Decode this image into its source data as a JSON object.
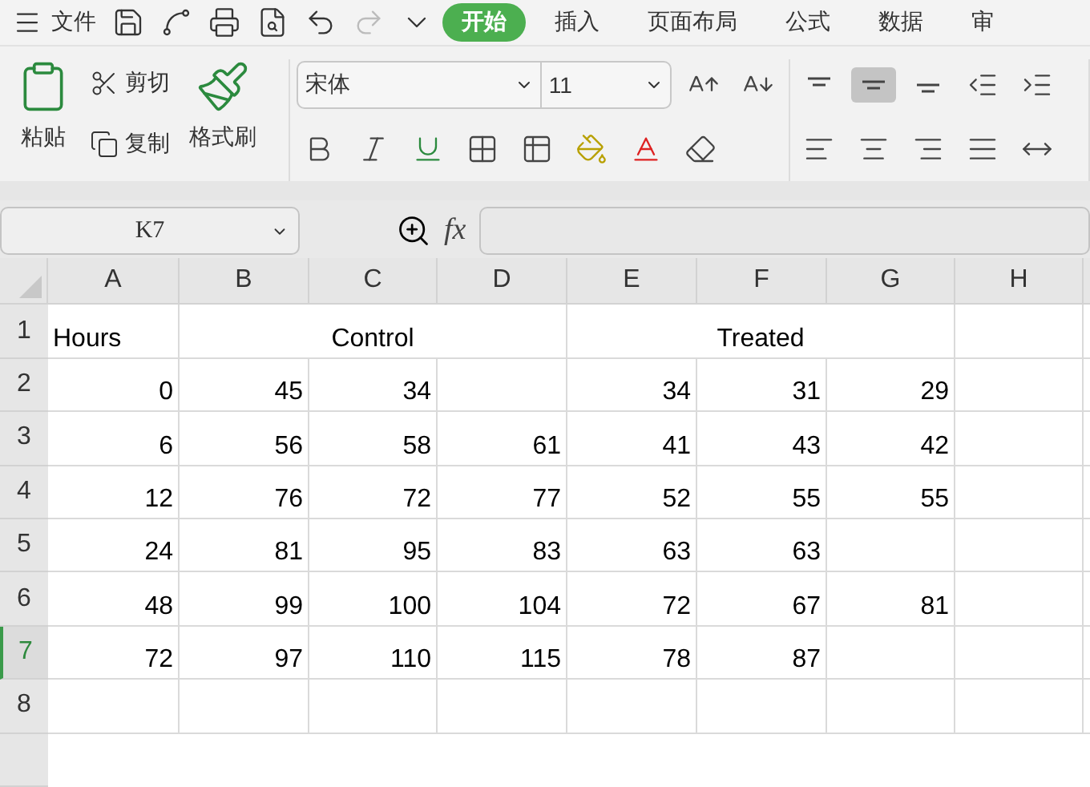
{
  "menu": {
    "label": "文件"
  },
  "tabs": [
    {
      "label": "开始",
      "selected": true
    },
    {
      "label": "插入",
      "selected": false
    },
    {
      "label": "页面布局",
      "selected": false
    },
    {
      "label": "公式",
      "selected": false
    },
    {
      "label": "数据",
      "selected": false
    },
    {
      "label": "审",
      "selected": false
    }
  ],
  "clipboard": {
    "paste": "粘贴",
    "cut": "剪切",
    "copy": "复制",
    "format_painter": "格式刷"
  },
  "font": {
    "name": "宋体",
    "size": "11"
  },
  "alignment": {
    "middle_selected": true
  },
  "formula_bar": {
    "cell_name": "K7",
    "fx": "fx"
  },
  "columns": [
    "A",
    "B",
    "C",
    "D",
    "E",
    "F",
    "G",
    "H"
  ],
  "rows": [
    {
      "label": "1",
      "selected": false,
      "kind": "groups",
      "cells": [
        "Hours",
        "Control",
        "Treated"
      ]
    },
    {
      "label": "2",
      "selected": false,
      "kind": "values",
      "cells": [
        "0",
        "45",
        "34",
        null,
        "34",
        "31",
        "29",
        null
      ]
    },
    {
      "label": "3",
      "selected": false,
      "kind": "values",
      "cells": [
        "6",
        "56",
        "58",
        "61",
        "41",
        "43",
        "42",
        null
      ]
    },
    {
      "label": "4",
      "selected": false,
      "kind": "values",
      "cells": [
        "12",
        "76",
        "72",
        "77",
        "52",
        "55",
        "55",
        null
      ]
    },
    {
      "label": "5",
      "selected": false,
      "kind": "values",
      "cells": [
        "24",
        "81",
        "95",
        "83",
        "63",
        "63",
        null,
        null
      ]
    },
    {
      "label": "6",
      "selected": false,
      "kind": "values",
      "cells": [
        "48",
        "99",
        "100",
        "104",
        "72",
        "67",
        "81",
        null
      ]
    },
    {
      "label": "7",
      "selected": true,
      "kind": "values",
      "cells": [
        "72",
        "97",
        "110",
        "115",
        "78",
        "87",
        null,
        null
      ]
    },
    {
      "label": "8",
      "selected": false,
      "kind": "values",
      "cells": [
        null,
        null,
        null,
        null,
        null,
        null,
        null,
        null
      ]
    }
  ]
}
